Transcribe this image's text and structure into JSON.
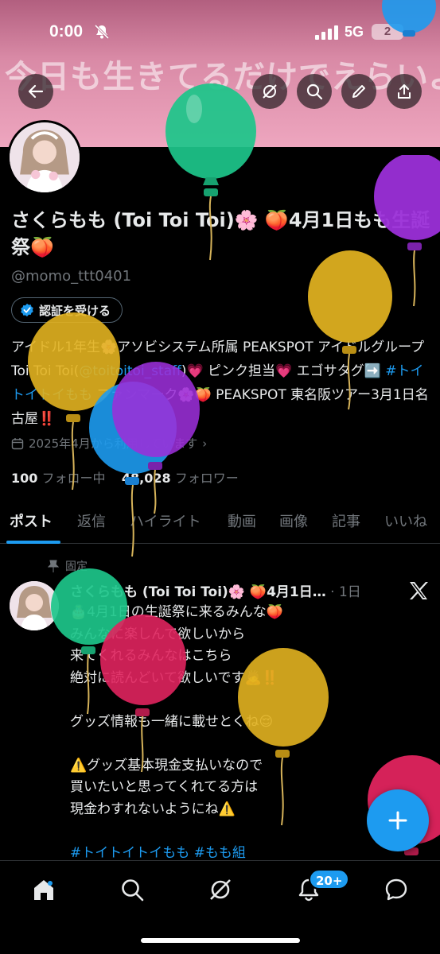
{
  "status_bar": {
    "time": "0:00",
    "network": "5G",
    "battery": "2"
  },
  "banner": {
    "text": "今日も生きてるだけでえらいよ♡"
  },
  "profile": {
    "name": "さくらもも (Toi Toi Toi)🌸 🍑4月1日もも生誕祭🍑",
    "handle": "@momo_ttt0401",
    "verify_label": "認証を受ける",
    "bio": {
      "part1": "アイドル1年生🌸アソビシステム所属 PEAKSPOT アイドルグループ Toi Toi Toi(",
      "mention": "@toitoitoi_staff",
      "part2": ")💗 ピンク担当💗 エゴサタグ➡️ ",
      "hashtag": "#トイトイトイもも",
      "part3": " ファンマーク🌸🍑 PEAKSPOT 東名阪ツアー3月1日名古屋‼️"
    },
    "joined": "2025年4月から利用しています",
    "following_count": "100",
    "following_label": "フォロー中",
    "followers_count": "48,028",
    "followers_label": "フォロワー"
  },
  "tabs": [
    "ポスト",
    "返信",
    "ハイライト",
    "動画",
    "画像",
    "記事",
    "いいね"
  ],
  "post": {
    "pinned_label": "固定",
    "author": "さくらもも (Toi Toi Toi)🌸 🍑4月1日…",
    "time": "· 1日",
    "lines": [
      "🎂4月1日の生誕祭に来るみんな🍑",
      "みんなに楽しんで欲しいから",
      "来てくれるみんなはこちら",
      "絶対に読んどいて欲しいです🙇‼️",
      "",
      "グッズ情報も一緒に載せとくね😌",
      "",
      "⚠️グッズ基本現金支払いなので",
      "買いたいと思ってくれてる方は",
      "現金わすれないようにね⚠️",
      ""
    ],
    "hashtags": "#トイトイトイもも #もも組"
  },
  "nav": {
    "notifications_badge": "20+"
  },
  "colors": {
    "accent": "#1d9bf0",
    "background": "#000000",
    "banner": "#e7a2bb"
  },
  "icons": [
    "back-arrow-icon",
    "no-grok-icon",
    "search-icon",
    "edit-icon",
    "share-icon",
    "verified-badge-icon",
    "calendar-icon",
    "pin-icon",
    "x-logo-icon",
    "plus-icon",
    "home-icon",
    "search-icon",
    "grok-icon",
    "bell-icon",
    "mail-icon"
  ]
}
